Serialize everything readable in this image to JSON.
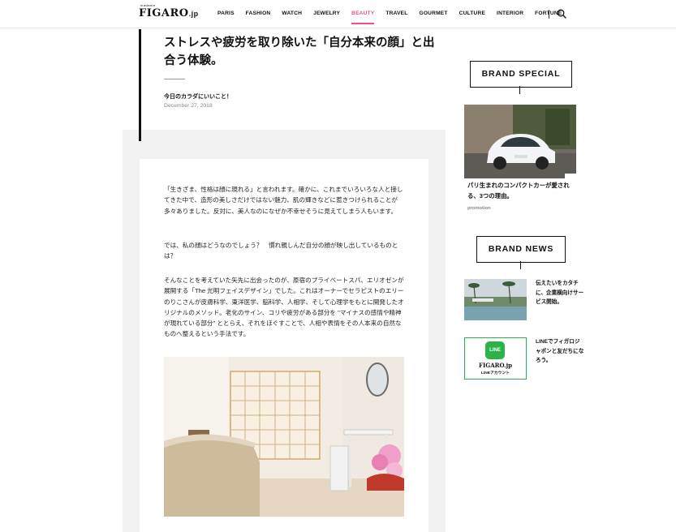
{
  "header": {
    "logo_small": "madame",
    "logo": "FIGARO",
    "logo_suffix": ".jp",
    "nav": [
      {
        "label": "PARIS",
        "active": false
      },
      {
        "label": "FASHION",
        "active": false
      },
      {
        "label": "WATCH",
        "active": false
      },
      {
        "label": "JEWELRY",
        "active": false
      },
      {
        "label": "BEAUTY",
        "active": true
      },
      {
        "label": "TRAVEL",
        "active": false
      },
      {
        "label": "GOURMET",
        "active": false
      },
      {
        "label": "CULTURE",
        "active": false
      },
      {
        "label": "INTERIOR",
        "active": false
      },
      {
        "label": "FORTUNE",
        "active": false
      }
    ],
    "accent_color": "#e6528a"
  },
  "article": {
    "title": "ストレスや疲労を取り除いた「自分本来の顔」と出合う体験。",
    "series": "今日のカラダにいいこと！",
    "date": "December 27, 2018",
    "paragraphs": [
      "「生きざま、性格は顔に現れる」と言われます。確かに、これまでいろいろな人と接してきた中で、造形の美しさだけではない魅力、肌の輝きなどに惹きつけられることが多々ありました。反対に、美人なのになぜか不幸せそうに見えてしまう人もいます。",
      "では、私の顔はどうなのでしょう？　慣れ親しんだ自分の顔が映し出しているものとは？",
      "そんなことを考えていた矢先に出会ったのが、原宿のプライベートスパ、エリオゼンが展開する「The 光明フェイスデザイン」でした。これはオーナーでセラピストのエリーのりこさんが皮膚科学、東洋医学、脳科学、人相学、そして心理学をもとに開発したオリジナルのメソッド。老化のサイン、コリや疲労がある部分を \"マイナスの感情や精神が現れている部分\" ととらえ、それをほぐすことで、人相や表情をその人本来の自然なものへ整えるという手法です。"
    ]
  },
  "sidebar": {
    "brand_special": {
      "heading": "BRAND SPECIAL",
      "card_title": "パリ生まれのコンパクトカーが愛される、3つの理由。",
      "card_label": "promotion"
    },
    "brand_news": {
      "heading": "BRAND NEWS",
      "items": [
        {
          "text": "伝えたいをカタチに、企業横向けサービス開始。"
        },
        {
          "text": "LINEでフィガロジャポンと友だちになろう。"
        }
      ],
      "line_badge": {
        "logo": "LINE",
        "brand": "FIGARO.jp",
        "caption": "LINEアカウント",
        "color": "#2bb34a"
      }
    }
  }
}
